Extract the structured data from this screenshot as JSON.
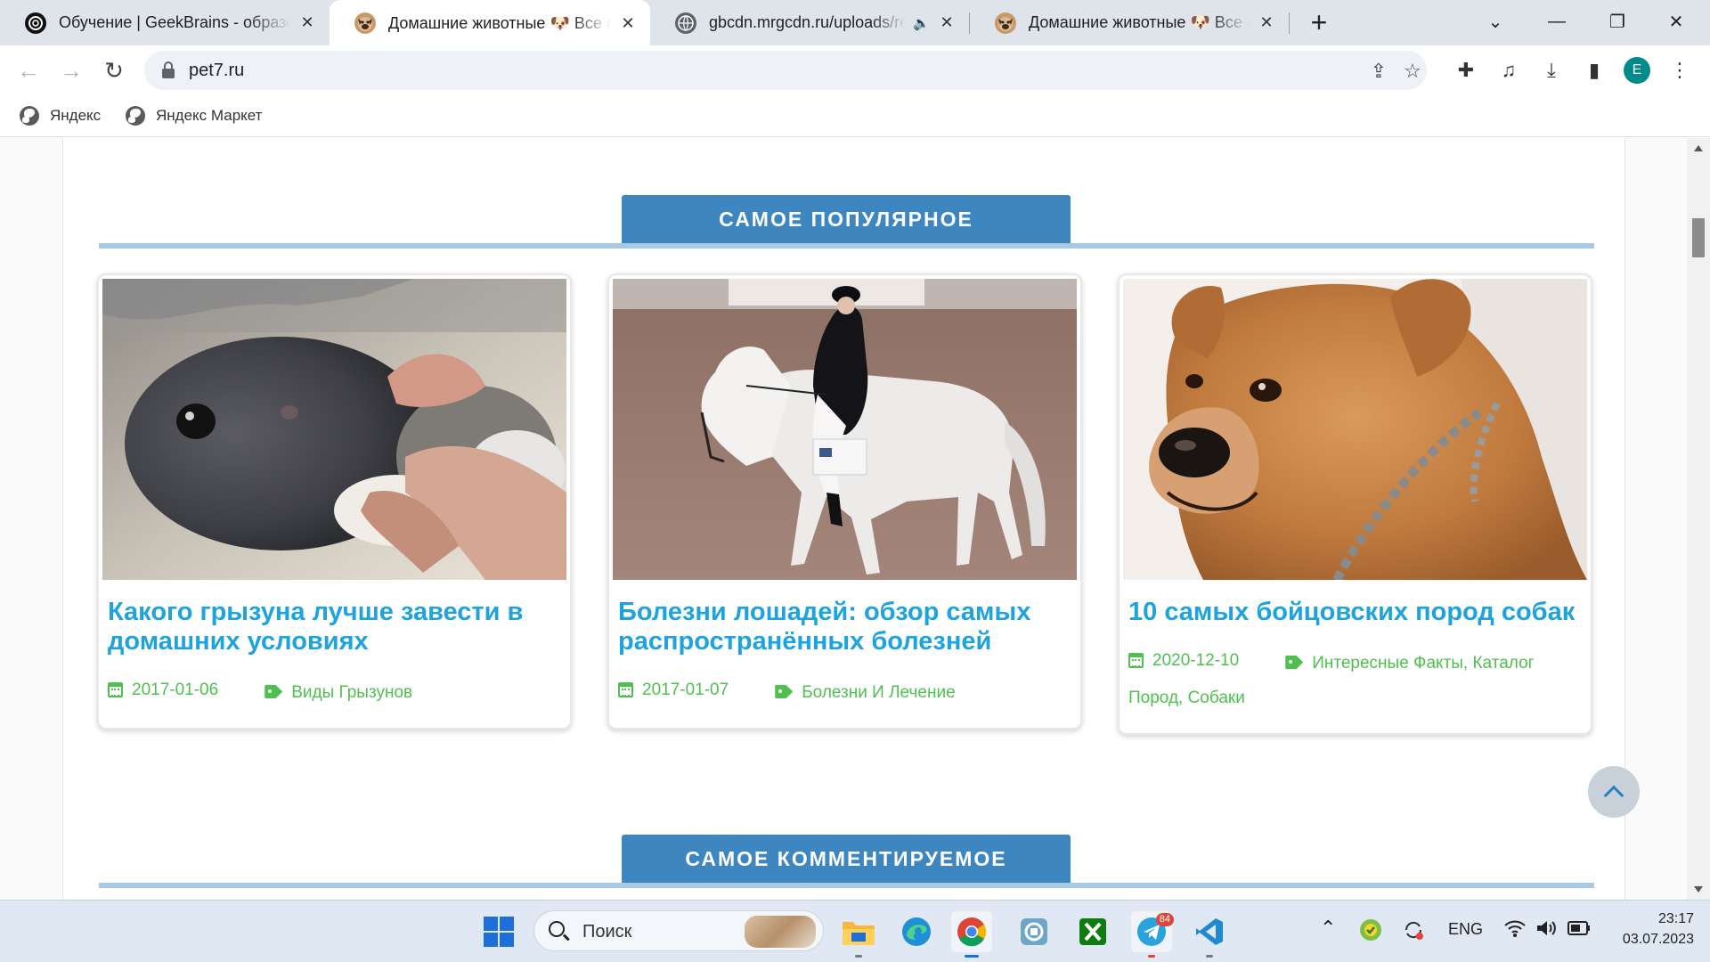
{
  "tabs": [
    {
      "title": "Обучение | GeekBrains - образовательный портал",
      "favicon": "openai-icon",
      "active": false
    },
    {
      "title": "Домашние животные 🐶 Все про домашних животных",
      "favicon": "pug-icon",
      "active": true
    },
    {
      "title": "gbcdn.mrgcdn.ru/uploads/record",
      "favicon": "globe-icon",
      "active": false,
      "audio": true
    },
    {
      "title": "Домашние животные 🐶 Все про домашних животных",
      "favicon": "pug-icon",
      "active": false
    }
  ],
  "tab_close_glyph": "✕",
  "new_tab_glyph": "+",
  "window_controls": {
    "dropdown": "⌄",
    "minimize": "—",
    "maximize": "❐",
    "close": "✕"
  },
  "toolbar": {
    "back": "←",
    "forward": "→",
    "reload": "↻",
    "url": "pet7.ru",
    "share": "⇪",
    "star": "☆",
    "extensions": "✚",
    "media": "♫",
    "download": "⤓",
    "sidepanel": "▮",
    "menu": "⋮",
    "profile_initial": "E"
  },
  "bookmarks": [
    {
      "label": "Яндекс"
    },
    {
      "label": "Яндекс Маркет"
    }
  ],
  "sections": [
    {
      "label": "САМОЕ ПОПУЛЯРНОЕ"
    },
    {
      "label": "САМОЕ КОММЕНТИРУЕМОЕ"
    }
  ],
  "cards": [
    {
      "title": "Какого грызуна лучше завести в домашних условиях",
      "date": "2017-01-06",
      "category": "Виды Грызунов",
      "image": "rabbit-photo"
    },
    {
      "title": "Болезни лошадей: обзор самых распространённых болезней",
      "date": "2017-01-07",
      "category": "Болезни И Лечение",
      "image": "horse-photo"
    },
    {
      "title": "10 самых бойцовских пород собак",
      "date": "2020-12-10",
      "category": "Интересные Факты, Каталог Пород, Собаки",
      "image": "dog-photo"
    }
  ],
  "taskbar": {
    "search_placeholder": "Поиск",
    "apps": [
      "windows-start-icon",
      "file-explorer-icon",
      "edge-icon",
      "chrome-icon",
      "app-icon",
      "xbox-icon",
      "telegram-icon",
      "vscode-icon"
    ],
    "telegram_badge": "84",
    "tray": {
      "chevron": "⌃",
      "lang": "ENG"
    },
    "time": "23:17",
    "date": "03.07.2023"
  }
}
